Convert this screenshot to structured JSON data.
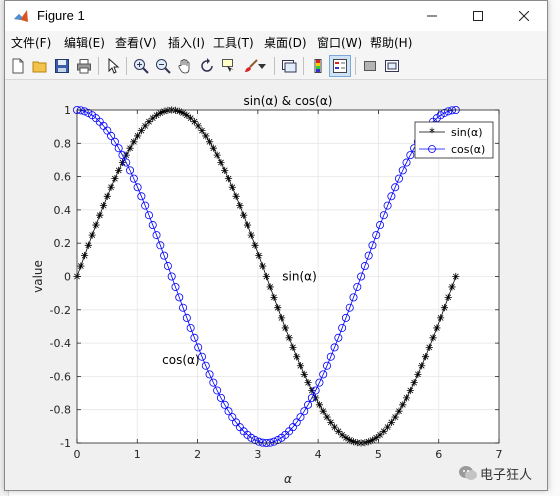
{
  "window": {
    "title": "Figure 1"
  },
  "menu": {
    "items": [
      "文件(F)",
      "编辑(E)",
      "查看(V)",
      "插入(I)",
      "工具(T)",
      "桌面(D)",
      "窗口(W)",
      "帮助(H)"
    ]
  },
  "toolbar": {
    "buttons": [
      "new-figure",
      "open-file",
      "save",
      "print",
      "edit-plot-pointer",
      "zoom-in",
      "zoom-out",
      "pan",
      "rotate-3d",
      "data-cursor",
      "brush",
      "link-plot",
      "insert-colorbar",
      "insert-legend",
      "hide-plot-tools",
      "show-plot-tools"
    ]
  },
  "watermark": {
    "text": "电子狂人"
  },
  "chart_data": {
    "type": "line",
    "title": "sin(α) & cos(α)",
    "xlabel": "α",
    "ylabel": "value",
    "xlim": [
      0,
      7
    ],
    "ylim": [
      -1,
      1
    ],
    "xticks": [
      "0",
      "1",
      "2",
      "3",
      "4",
      "5",
      "6",
      "7"
    ],
    "yticks": [
      "-1",
      "-0.8",
      "-0.6",
      "-0.4",
      "-0.2",
      "0",
      "0.2",
      "0.4",
      "0.6",
      "0.8",
      "1"
    ],
    "grid": true,
    "legend_position": "top-right",
    "x_domain": {
      "start": 0,
      "end": 6.2832,
      "points": 101
    },
    "series": [
      {
        "name": "sin(α)",
        "function": "sin",
        "color": "#000000",
        "marker": "*"
      },
      {
        "name": "cos(α)",
        "function": "cos",
        "color": "#0000ff",
        "marker": "o"
      }
    ],
    "annotations": [
      {
        "text": "sin(α)",
        "x": 3.14,
        "y": 0
      },
      {
        "text": "cos(α)",
        "x": 2.1,
        "y": -0.5
      }
    ]
  }
}
